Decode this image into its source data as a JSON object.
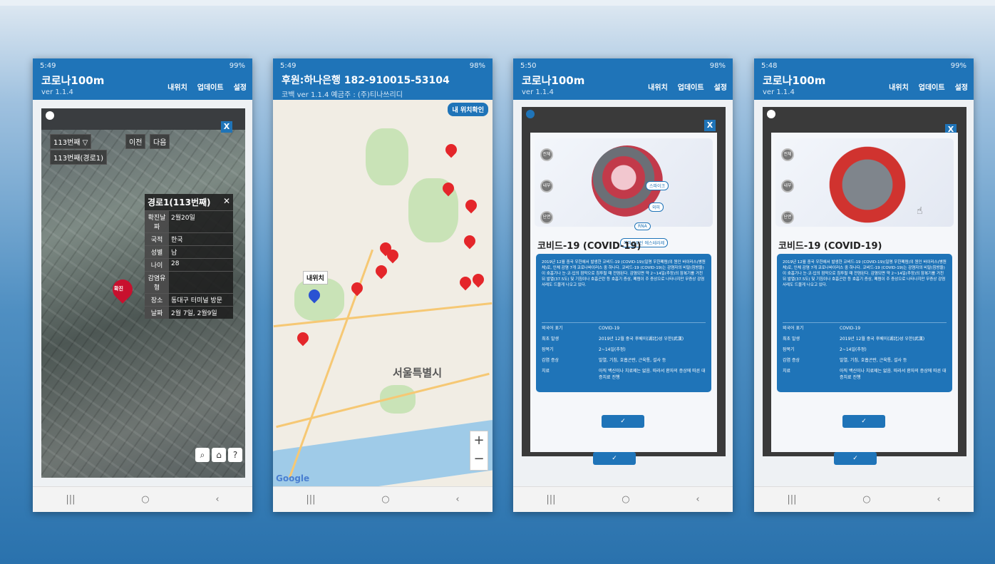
{
  "phones": [
    {
      "status_time": "5:49",
      "status_right": "99%",
      "app_title": "코로나100m",
      "app_version": "ver 1.1.4",
      "menu": [
        "내위치",
        "업데이트",
        "설정"
      ],
      "map_controls": {
        "case_selector": "113번째 ▽",
        "prev": "이전",
        "next": "다음",
        "route": "113번째(경로1)"
      },
      "info_panel": {
        "title": "경로1(113번째)",
        "rows": [
          {
            "k": "확진날짜",
            "v": "2월20일"
          },
          {
            "k": "국적",
            "v": "한국"
          },
          {
            "k": "성별",
            "v": "남"
          },
          {
            "k": "나이",
            "v": "28"
          },
          {
            "k": "감염유형",
            "v": ""
          },
          {
            "k": "장소",
            "v": "동대구 터미널 방문"
          },
          {
            "k": "날짜",
            "v": "2월 7일, 2월9일"
          }
        ]
      },
      "pin_label": "확진"
    },
    {
      "status_time": "5:49",
      "status_right": "98%",
      "sponsor_title": "후원:하나은행 182-910015-53104",
      "sponsor_sub": "코백 ver 1.1.4     예금주 : (주)티나쓰리디",
      "my_location_button": "내 위치확인",
      "my_location_label": "내위치",
      "city_label": "서울특별시",
      "zoom_in": "+",
      "zoom_out": "−",
      "map_logo": "Google"
    },
    {
      "status_time": "5:50",
      "status_right": "98%",
      "app_title": "코로나100m",
      "app_version": "ver 1.1.4",
      "menu": [
        "내위치",
        "업데이트",
        "설정"
      ]
    },
    {
      "status_time": "5:48",
      "status_right": "99%",
      "app_title": "코로나100m",
      "app_version": "ver 1.1.4",
      "menu": [
        "내위치",
        "업데이트",
        "설정"
      ]
    }
  ],
  "covid_card": {
    "title": "코비드-19 (COVID-19)",
    "description": "2019년 12월 중국 우한에서 발생한 코비드-19 (COVID-19)(일명 우한폐렴)의 원인 바이러스(병원체)로, 인체 감염 7개 코로나바이러스 중 하나다. 코비드-19 (COVID-19)는 감염자의 비말(침방울)이 호흡기나 눈·코·입의 점막으로 침투될 때 전염된다. 감염되면 약 2~14일(추정)의 잠복기를 거친 뒤 발열(37.5도) 및 기침이나 호흡곤란 등 호흡기 증상, 폐렴이 주 증상으로 나타나지만 무증상 감염 사례도 드물게 나오고 있다.",
    "rows": [
      {
        "k": "외국어 표기",
        "v": "COVID-19"
      },
      {
        "k": "최초 발생",
        "v": "2019년 12월 중국 후베이(湖北)성 우한(武漢)"
      },
      {
        "k": "잠복기",
        "v": "2~14일(추정)"
      },
      {
        "k": "감염 증상",
        "v": "발열, 기침, 호흡곤란, 근육통, 설사 등"
      },
      {
        "k": "치료",
        "v": "아직 백신이나 치료제는 없음. 따라서 환자의 증상에 따른 대증치료 진행"
      }
    ],
    "tags": [
      "스파이크",
      "외피",
      "RNA",
      "헤마글루틴 에스테라제"
    ],
    "stages": [
      "전체",
      "내부",
      "단면"
    ],
    "ok_icon": "✓"
  },
  "nav_icons": [
    "|||",
    "○",
    "‹"
  ]
}
